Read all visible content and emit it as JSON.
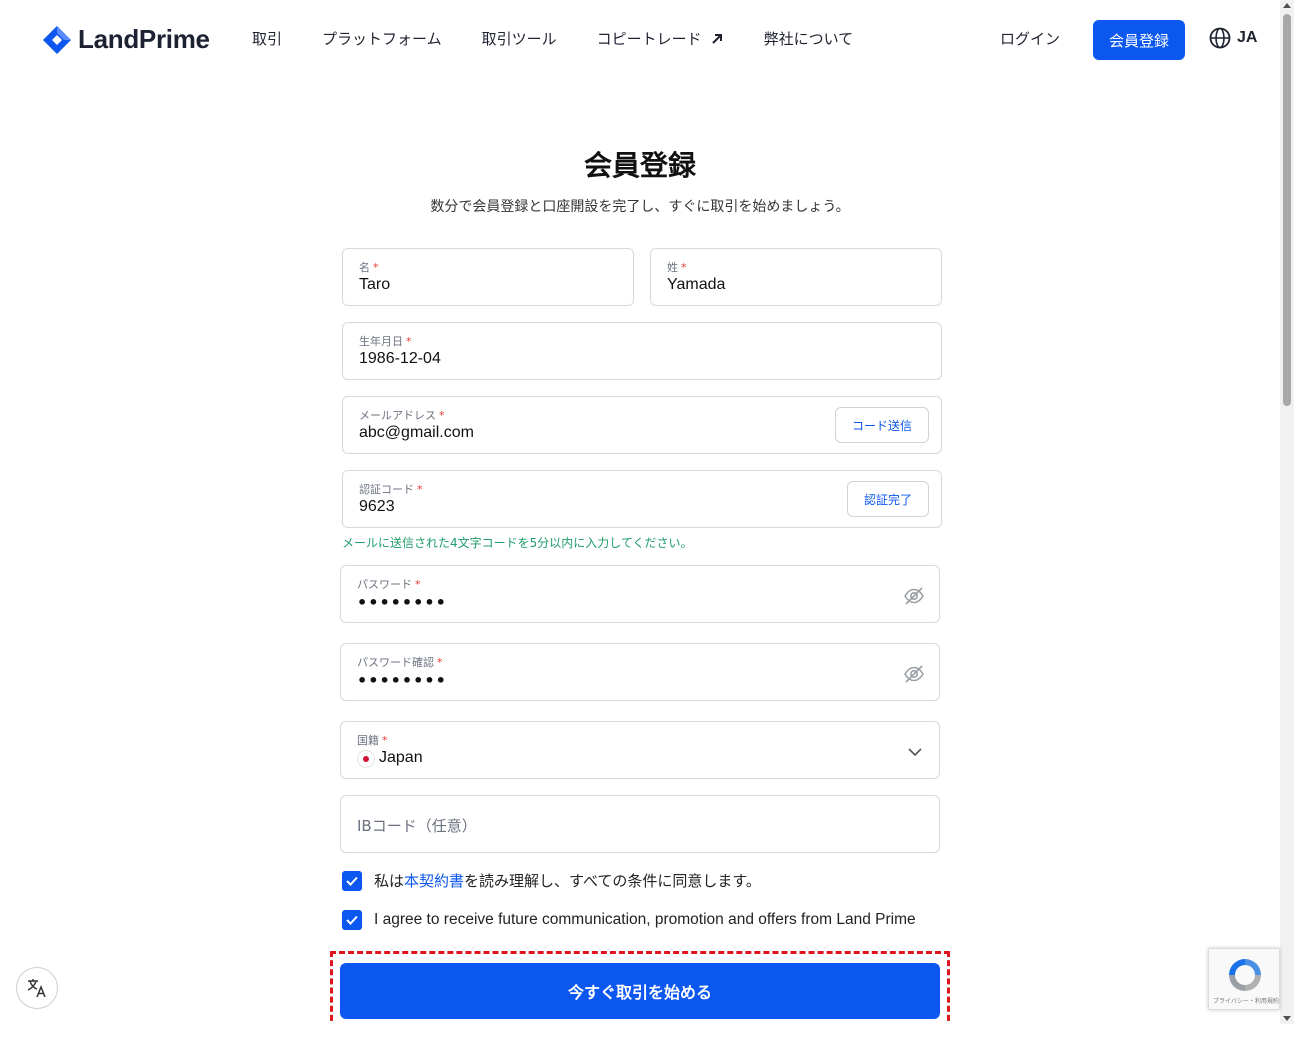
{
  "header": {
    "logo_text": "LandPrime",
    "nav": [
      "取引",
      "プラットフォーム",
      "取引ツール",
      "コピートレード",
      "弊社について"
    ],
    "login": "ログイン",
    "signup": "会員登録",
    "lang": "JA",
    "brand_color": "#0b57f0"
  },
  "page": {
    "title": "会員登録",
    "subtitle": "数分で会員登録と口座開設を完了し、すぐに取引を始めましょう。"
  },
  "form": {
    "first_name": {
      "label": "名",
      "value": "Taro"
    },
    "last_name": {
      "label": "姓",
      "value": "Yamada"
    },
    "birthdate": {
      "label": "生年月日",
      "value": "1986-12-04"
    },
    "email": {
      "label": "メールアドレス",
      "value": "abc@gmail.com",
      "button": "コード送信"
    },
    "code": {
      "label": "認証コード",
      "value": "9623",
      "button": "認証完了"
    },
    "code_hint": "メールに送信された4文字コードを5分以内に入力してください。",
    "password": {
      "label": "パスワード",
      "value": "••••••••"
    },
    "password_confirm": {
      "label": "パスワード確認",
      "value": "••••••••"
    },
    "nationality": {
      "label": "国籍",
      "value": "Japan"
    },
    "ib_code": {
      "placeholder": "IBコード（任意）"
    },
    "required_mark": "*",
    "agree_prefix": "私は",
    "agree_link": "本契約書",
    "agree_suffix": "を読み理解し、すべての条件に同意します。",
    "marketing": "I agree to receive future communication, promotion and offers from Land Prime",
    "submit": "今すぐ取引を始める"
  },
  "recaptcha": {
    "text": "プライバシー・利用規約"
  }
}
